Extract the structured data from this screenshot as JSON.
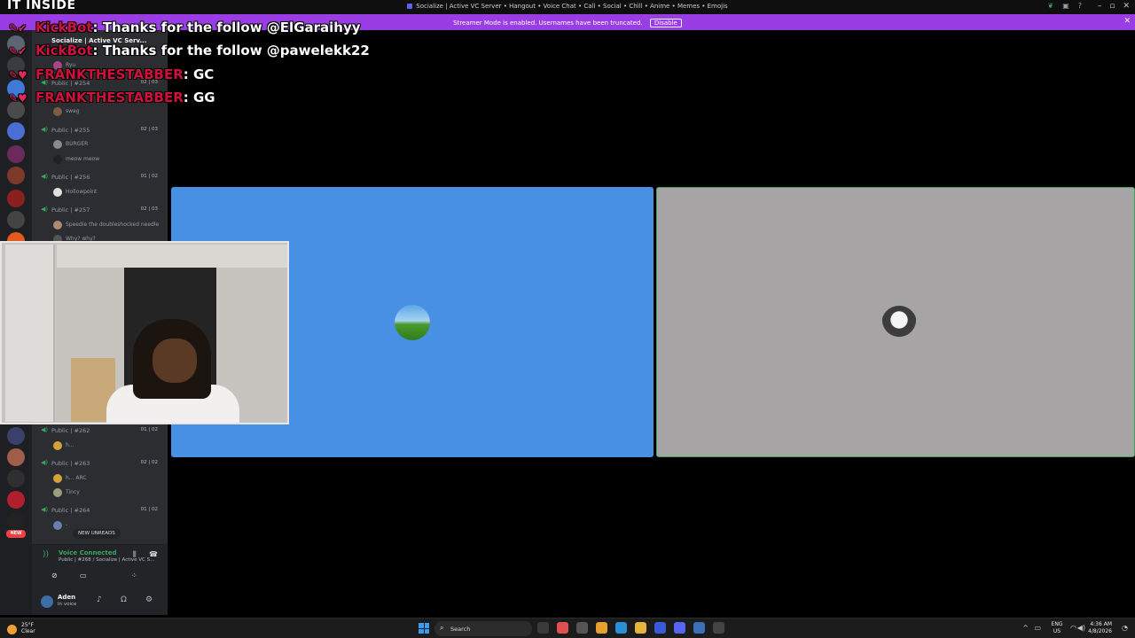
{
  "window": {
    "title": "Socialize | Active VC Server • Hangout • Voice Chat • Call • Social • Chill • Anime • Memes • Emojis"
  },
  "streamer_banner": {
    "message": "Streamer Mode is enabled. Usernames have been truncated.",
    "disable_label": "Disable"
  },
  "stream_overlay": {
    "header": "IT INSIDE",
    "chat": [
      {
        "name": "KickBot",
        "message": ": Thanks for the follow @ElGaraihyy"
      },
      {
        "name": "KickBot",
        "message": ": Thanks for the follow @pawelekk22"
      },
      {
        "name": "FRANKTHESTABBER",
        "message": ": GC"
      },
      {
        "name": "FRANKTHESTABBER",
        "message": ": GG"
      }
    ]
  },
  "sidebar": {
    "server_name": "Socialize | Active VC Serv...",
    "voice_channels": [
      {
        "name": "Public | #254",
        "count": "02 | 03"
      },
      {
        "name": "Public | #255",
        "count": "02 | 03"
      },
      {
        "name": "Public | #256",
        "count": "01 | 02"
      },
      {
        "name": "Public | #257",
        "count": "02 | 03"
      },
      {
        "name": "Public | #262",
        "count": "01 | 02"
      },
      {
        "name": "Public | #263",
        "count": "02 | 02"
      },
      {
        "name": "Public | #264",
        "count": "01 | 02"
      }
    ],
    "users": {
      "ryu": "Ryu",
      "u254": "swag",
      "burger": "BURGER",
      "meow": "meow  meow",
      "hollowpoint": "Hollowpoint",
      "speedie": "Speedie the doubleshocked needle",
      "why": "Why? why?",
      "u262": "h...",
      "arc": "h...  ARC",
      "tincy": "Tincy",
      "u264": "-"
    },
    "new_unreads": "NEW UNREADS",
    "new_badge": "NEW",
    "voice_connected": {
      "status": "Voice Connected",
      "channel": "Public | #268 / Socialize | Active VC Ser..."
    },
    "user_panel": {
      "name": "Aden",
      "status": "In voice"
    }
  },
  "taskbar": {
    "weather_temp": "25°F",
    "weather_desc": "Clear",
    "search_label": "Search",
    "lang_top": "ENG",
    "lang_bottom": "US",
    "time": "4:36 AM",
    "date": "4/8/2026"
  },
  "colors": {
    "tile_a": "#4790e3",
    "tile_b": "#a6a4a4",
    "banner": "#9b3de4",
    "voice_green": "#3ba55c"
  }
}
